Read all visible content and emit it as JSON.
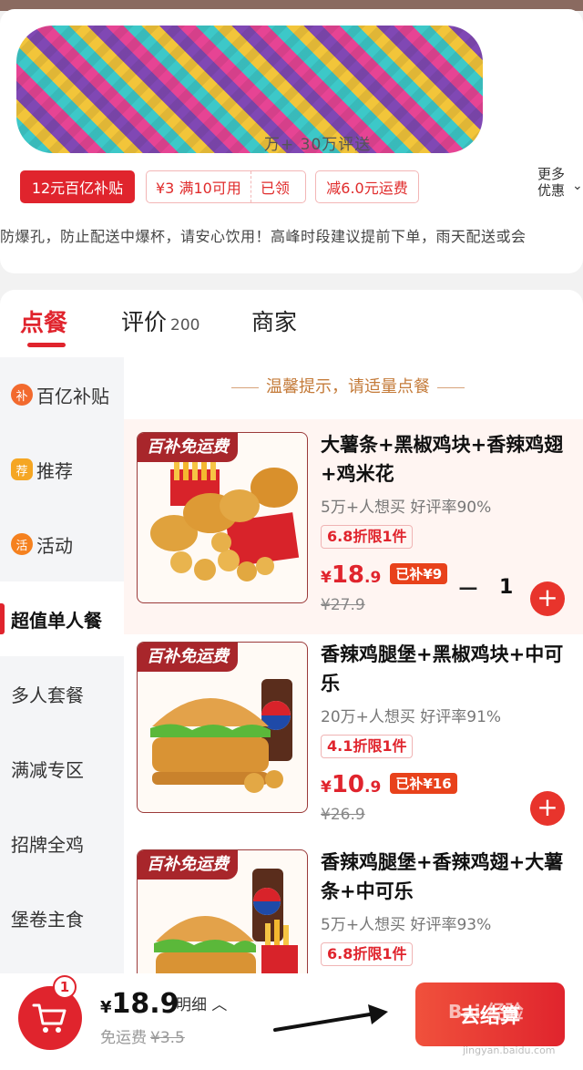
{
  "store": {
    "stats_text": "万+   30万评送",
    "tags": {
      "subsidy": "12元百亿补贴",
      "coupon_amount": "¥3 满10可用",
      "coupon_status": "已领",
      "shipping": "减6.0元运费"
    },
    "more_line1": "更多",
    "more_line2": "优惠",
    "notice": "防爆孔，防止配送中爆杯，请安心饮用！高峰时段建议提前下单，雨天配送或会"
  },
  "tabs": {
    "order": "点餐",
    "reviews": "评价",
    "reviews_count": "200",
    "merchant": "商家"
  },
  "sidebar": {
    "items": [
      {
        "label": "百亿补贴",
        "icon": "补"
      },
      {
        "label": "推荐",
        "icon": "荐"
      },
      {
        "label": "活动",
        "icon": "活"
      },
      {
        "label": "超值单人餐"
      },
      {
        "label": "多人套餐"
      },
      {
        "label": "满减专区"
      },
      {
        "label": "招牌全鸡"
      },
      {
        "label": "堡卷主食"
      }
    ]
  },
  "hint": "温馨提示，请适量点餐",
  "products": [
    {
      "badge": "百补免运费",
      "title": "大薯条+黑椒鸡块+香辣鸡翅+鸡米花",
      "sales": "5万+人想买  好评率90%",
      "discount": "6.8折限1件",
      "price_currency": "¥",
      "price_int": "18",
      "price_dec": ".9",
      "subsidy": "已补¥9",
      "original": "¥27.9",
      "qty_minus": "−",
      "qty": "1",
      "qty_plus": "+"
    },
    {
      "badge": "百补免运费",
      "title": "香辣鸡腿堡+黑椒鸡块+中可乐",
      "sales": "20万+人想买  好评率91%",
      "discount": "4.1折限1件",
      "price_currency": "¥",
      "price_int": "10",
      "price_dec": ".9",
      "subsidy": "已补¥16",
      "original": "¥26.9",
      "qty_plus": "+"
    },
    {
      "badge": "百补免运费",
      "title": "香辣鸡腿堡+香辣鸡翅+大薯条+中可乐",
      "sales": "5万+人想买  好评率93%",
      "discount": "6.8折限1件"
    }
  ],
  "cart": {
    "badge": "1",
    "currency": "¥",
    "total": "18.9",
    "detail": "明细 ︿",
    "freeship": "免运费",
    "freeship_old": "¥3.5",
    "checkout": "去结算"
  },
  "watermark": "Bai 经验",
  "watermark_url": "jingyan.baidu.com",
  "colors": {
    "accent": "#e0242d",
    "badge": "#a8262b",
    "subsidy": "#e8421b"
  }
}
